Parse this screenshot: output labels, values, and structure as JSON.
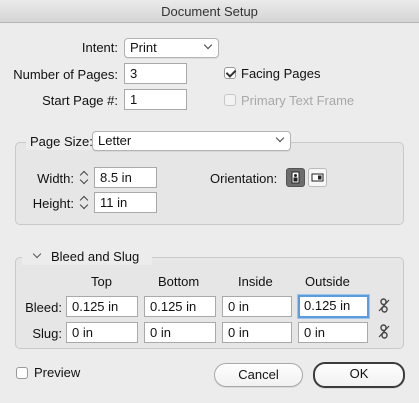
{
  "dialog": {
    "title": "Document Setup"
  },
  "intent": {
    "label": "Intent:",
    "value": "Print"
  },
  "pages": {
    "count_label": "Number of Pages:",
    "count_value": "3",
    "start_label": "Start Page #:",
    "start_value": "1",
    "facing_label": "Facing Pages",
    "facing_checked": true,
    "primary_label": "Primary Text Frame",
    "primary_checked": false
  },
  "page_size": {
    "label": "Page Size:",
    "value": "Letter",
    "width_label": "Width:",
    "width_value": "8.5 in",
    "height_label": "Height:",
    "height_value": "11 in",
    "orientation_label": "Orientation:",
    "orientation_selected": "portrait"
  },
  "bleed_slug": {
    "section_label": "Bleed and Slug",
    "columns": [
      "Top",
      "Bottom",
      "Inside",
      "Outside"
    ],
    "bleed_label": "Bleed:",
    "bleed_values": [
      "0.125 in",
      "0.125 in",
      "0 in",
      "0.125 in"
    ],
    "slug_label": "Slug:",
    "slug_values": [
      "0 in",
      "0 in",
      "0 in",
      "0 in"
    ]
  },
  "footer": {
    "preview_label": "Preview",
    "cancel_label": "Cancel",
    "ok_label": "OK"
  },
  "icons": {
    "orientation_portrait": "portrait-page-icon",
    "orientation_landscape": "landscape-page-icon",
    "chain": "broken-chain-link-icon",
    "checkbox": "checkmark-icon"
  },
  "colors": {
    "focus_ring": "#5b9bde",
    "active_orientation": "#6d6d6d",
    "default_button_border": "#3c3c3c"
  }
}
